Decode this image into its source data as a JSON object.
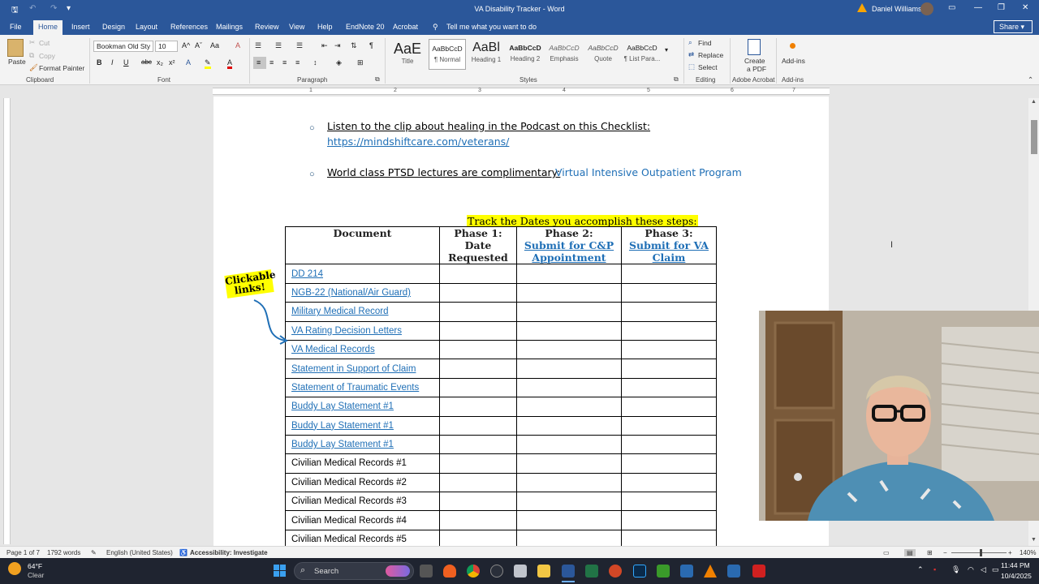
{
  "window": {
    "title": "VA Disability Tracker  -  Word",
    "user": "Daniel Williams",
    "min": "—",
    "restore": "❐",
    "close": "✕",
    "undo": "↶",
    "redo": "↷",
    "customize": "▾"
  },
  "tabs": [
    "File",
    "Home",
    "Insert",
    "Design",
    "Layout",
    "References",
    "Mailings",
    "Review",
    "View",
    "Help",
    "EndNote 20",
    "Acrobat"
  ],
  "tell_me": "Tell me what you want to do",
  "share_label": "Share",
  "ribbon": {
    "clipboard": {
      "paste": "Paste",
      "cut": "Cut",
      "copy": "Copy",
      "format_painter": "Format Painter",
      "group": "Clipboard"
    },
    "font": {
      "name": "Bookman Old Sty",
      "size": "10",
      "group": "Font",
      "bold": "B",
      "italic": "I",
      "underline": "U",
      "strike": "abc",
      "sub": "x₂",
      "sup": "x²",
      "grow": "A^",
      "shrink": "Aˇ",
      "case": "Aa",
      "clear": "A"
    },
    "paragraph": {
      "group": "Paragraph"
    },
    "styles": {
      "group": "Styles",
      "items": [
        {
          "preview": "AaE",
          "name": "Title"
        },
        {
          "preview": "AaBbCcD",
          "name": "¶ Normal"
        },
        {
          "preview": "AaBl",
          "name": "Heading 1"
        },
        {
          "preview": "AaBbCcD",
          "name": "Heading 2"
        },
        {
          "preview": "AaBbCcD",
          "name": "Emphasis"
        },
        {
          "preview": "AaBbCcD",
          "name": "Quote"
        },
        {
          "preview": "AaBbCcD",
          "name": "¶ List Para..."
        }
      ]
    },
    "editing": {
      "find": "Find",
      "replace": "Replace",
      "select": "Select",
      "group": "Editing"
    },
    "acrobat": {
      "create_line1": "Create",
      "create_line2": "a PDF",
      "group": "Adobe Acrobat"
    },
    "addins": {
      "label": "Add-ins",
      "group": "Add-ins"
    }
  },
  "ruler_numbers": [
    "1",
    "2",
    "3",
    "4",
    "5",
    "6",
    "7"
  ],
  "document": {
    "bullet1_text": "Listen to the clip about healing in the Podcast on this Checklist:",
    "bullet1_link": "https://mindshiftcare.com/veterans/",
    "bullet2_text": "World class PTSD lectures are complimentary:",
    "bullet2_link": "Virtual Intensive Outpatient Program",
    "highlight": "Track the Dates you accomplish these steps:",
    "callout_line1": "Clickable",
    "callout_line2": "links!",
    "headers": {
      "document": "Document",
      "phase1_line1": "Phase 1:",
      "phase1_line2": "Date",
      "phase1_line3": "Requested",
      "phase2_line1": "Phase 2:",
      "phase2_line2": "Submit for C&P",
      "phase2_line3": "Appointment",
      "phase3_line1": "Phase 3:",
      "phase3_line2": "Submit for VA",
      "phase3_line3": "Claim"
    },
    "rows": [
      {
        "label": "DD 214",
        "link": true
      },
      {
        "label": "NGB-22 (National/Air Guard)",
        "link": true
      },
      {
        "label": "Military Medical Record",
        "link": true
      },
      {
        "label": "VA Rating Decision Letters",
        "link": true
      },
      {
        "label": "VA Medical Records",
        "link": true
      },
      {
        "label": "Statement in Support of Claim",
        "link": true
      },
      {
        "label": "Statement of Traumatic Events",
        "link": true
      },
      {
        "label": "Buddy Lay Statement #1",
        "link": true
      },
      {
        "label": "Buddy Lay Statement #1",
        "link": true
      },
      {
        "label": "Buddy Lay Statement #1",
        "link": true
      },
      {
        "label": "Civilian Medical Records #1",
        "link": false
      },
      {
        "label": "Civilian Medical Records #2",
        "link": false
      },
      {
        "label": "Civilian Medical Records #3",
        "link": false
      },
      {
        "label": "Civilian Medical Records #4",
        "link": false
      },
      {
        "label": "Civilian Medical Records #5",
        "link": false
      }
    ]
  },
  "status": {
    "page": "Page 1 of 7",
    "words": "1792 words",
    "language": "English (United States)",
    "accessibility": "Accessibility: Investigate",
    "zoom": "140%"
  },
  "taskbar": {
    "temp": "64°F",
    "weather": "Clear",
    "search": "Search",
    "time": "11:44 PM",
    "date": "10/4/2025"
  },
  "colors": {
    "word_blue": "#2b579a",
    "link": "#1f6fb6",
    "highlight": "#ffff00",
    "taskbar": "#1f2430"
  }
}
